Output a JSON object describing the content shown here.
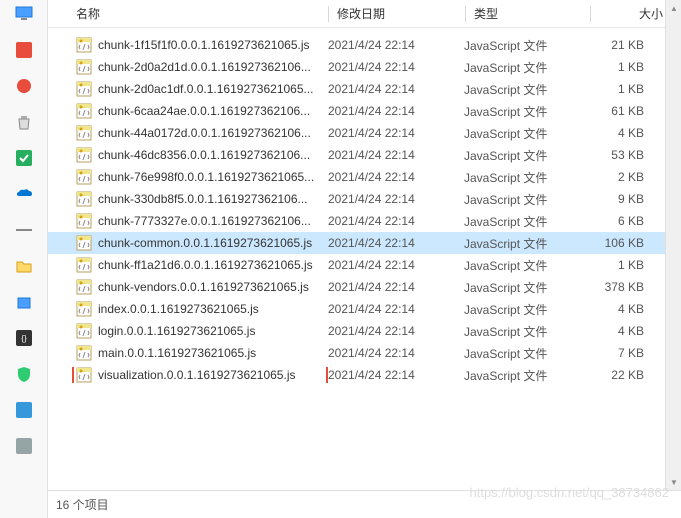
{
  "headers": {
    "name": "名称",
    "date": "修改日期",
    "type": "类型",
    "size": "大小"
  },
  "files": [
    {
      "name": "chunk-1f15f1f0.0.0.1.1619273621065.js",
      "date": "2021/4/24 22:14",
      "type": "JavaScript 文件",
      "size": "21 KB",
      "selected": false,
      "highlighted": false
    },
    {
      "name": "chunk-2d0a2d1d.0.0.1.161927362106...",
      "date": "2021/4/24 22:14",
      "type": "JavaScript 文件",
      "size": "1 KB",
      "selected": false,
      "highlighted": false
    },
    {
      "name": "chunk-2d0ac1df.0.0.1.1619273621065...",
      "date": "2021/4/24 22:14",
      "type": "JavaScript 文件",
      "size": "1 KB",
      "selected": false,
      "highlighted": false
    },
    {
      "name": "chunk-6caa24ae.0.0.1.161927362106...",
      "date": "2021/4/24 22:14",
      "type": "JavaScript 文件",
      "size": "61 KB",
      "selected": false,
      "highlighted": false
    },
    {
      "name": "chunk-44a0172d.0.0.1.161927362106...",
      "date": "2021/4/24 22:14",
      "type": "JavaScript 文件",
      "size": "4 KB",
      "selected": false,
      "highlighted": false
    },
    {
      "name": "chunk-46dc8356.0.0.1.161927362106...",
      "date": "2021/4/24 22:14",
      "type": "JavaScript 文件",
      "size": "53 KB",
      "selected": false,
      "highlighted": false
    },
    {
      "name": "chunk-76e998f0.0.0.1.1619273621065...",
      "date": "2021/4/24 22:14",
      "type": "JavaScript 文件",
      "size": "2 KB",
      "selected": false,
      "highlighted": false
    },
    {
      "name": "chunk-330db8f5.0.0.1.161927362106...",
      "date": "2021/4/24 22:14",
      "type": "JavaScript 文件",
      "size": "9 KB",
      "selected": false,
      "highlighted": false
    },
    {
      "name": "chunk-7773327e.0.0.1.161927362106...",
      "date": "2021/4/24 22:14",
      "type": "JavaScript 文件",
      "size": "6 KB",
      "selected": false,
      "highlighted": false
    },
    {
      "name": "chunk-common.0.0.1.1619273621065.js",
      "date": "2021/4/24 22:14",
      "type": "JavaScript 文件",
      "size": "106 KB",
      "selected": true,
      "highlighted": false
    },
    {
      "name": "chunk-ff1a21d6.0.0.1.1619273621065.js",
      "date": "2021/4/24 22:14",
      "type": "JavaScript 文件",
      "size": "1 KB",
      "selected": false,
      "highlighted": false
    },
    {
      "name": "chunk-vendors.0.0.1.1619273621065.js",
      "date": "2021/4/24 22:14",
      "type": "JavaScript 文件",
      "size": "378 KB",
      "selected": false,
      "highlighted": false
    },
    {
      "name": "index.0.0.1.1619273621065.js",
      "date": "2021/4/24 22:14",
      "type": "JavaScript 文件",
      "size": "4 KB",
      "selected": false,
      "highlighted": false
    },
    {
      "name": "login.0.0.1.1619273621065.js",
      "date": "2021/4/24 22:14",
      "type": "JavaScript 文件",
      "size": "4 KB",
      "selected": false,
      "highlighted": false
    },
    {
      "name": "main.0.0.1.1619273621065.js",
      "date": "2021/4/24 22:14",
      "type": "JavaScript 文件",
      "size": "7 KB",
      "selected": false,
      "highlighted": false
    },
    {
      "name": "visualization.0.0.1.1619273621065.js",
      "date": "2021/4/24 22:14",
      "type": "JavaScript 文件",
      "size": "22 KB",
      "selected": false,
      "highlighted": true
    }
  ],
  "status": {
    "count": "16 个项目"
  },
  "watermark": "https://blog.csdn.net/qq_38734862",
  "sidebar_icons": [
    "monitor-icon",
    "red-app-icon",
    "red-circle-icon",
    "recycle-bin-icon",
    "green-check-icon",
    "onedrive-icon",
    "line-icon",
    "folder-icon",
    "device-icon",
    "code-icon",
    "shield-icon",
    "app-icon",
    "misc-icon"
  ]
}
